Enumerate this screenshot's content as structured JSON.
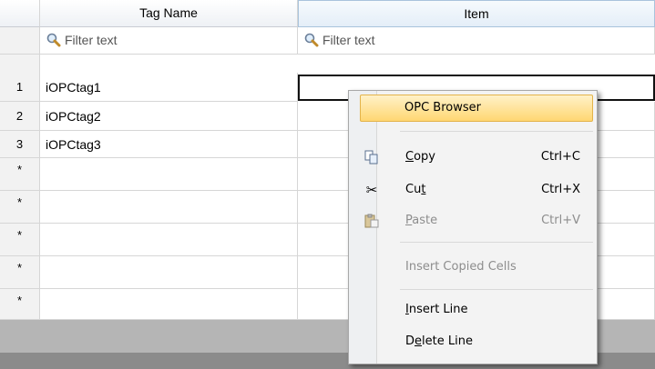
{
  "grid": {
    "columns": [
      "Tag Name",
      "Item"
    ],
    "filter_placeholder": "Filter text",
    "rows": [
      {
        "num": "1",
        "tag": "iOPCtag1",
        "item": ""
      },
      {
        "num": "2",
        "tag": "iOPCtag2",
        "item": ""
      },
      {
        "num": "3",
        "tag": "iOPCtag3",
        "item": ""
      },
      {
        "num": "*",
        "tag": "",
        "item": ""
      },
      {
        "num": "*",
        "tag": "",
        "item": ""
      },
      {
        "num": "*",
        "tag": "",
        "item": ""
      },
      {
        "num": "*",
        "tag": "",
        "item": ""
      },
      {
        "num": "*",
        "tag": "",
        "item": ""
      }
    ]
  },
  "context_menu": {
    "opc_browser": "OPC Browser",
    "copy": {
      "pre": "",
      "u": "C",
      "post": "opy",
      "shortcut": "Ctrl+C"
    },
    "cut": {
      "pre": "Cu",
      "u": "t",
      "post": "",
      "shortcut": "Ctrl+X"
    },
    "paste": {
      "pre": "",
      "u": "P",
      "post": "aste",
      "shortcut": "Ctrl+V"
    },
    "insert_copied": "Insert Copied Cells",
    "insert_line": {
      "pre": "",
      "u": "I",
      "post": "nsert Line"
    },
    "delete_line": {
      "pre": "D",
      "u": "e",
      "post": "lete Line"
    }
  },
  "icons": [
    "magnifier-icon",
    "copy-icon",
    "scissors-icon",
    "paste-icon"
  ]
}
